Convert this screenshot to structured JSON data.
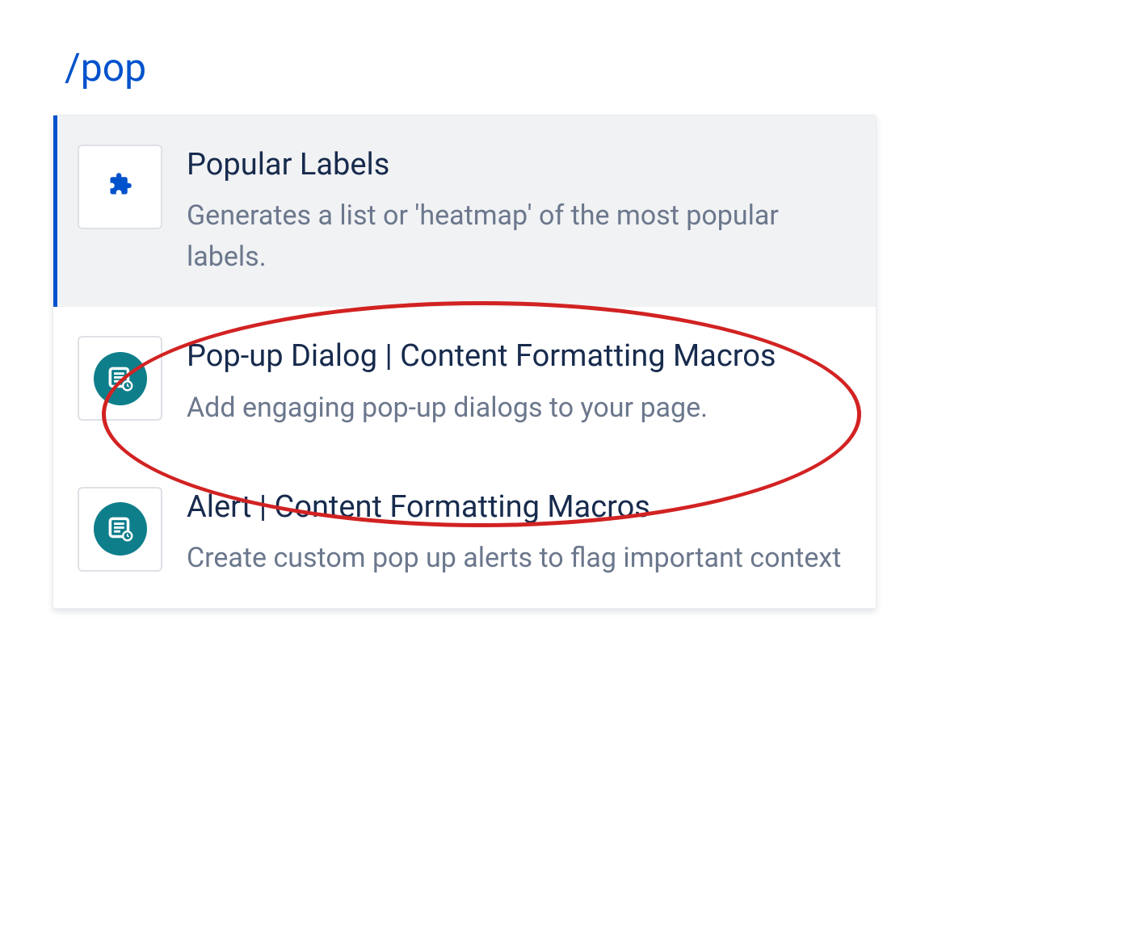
{
  "slash_input": "/pop",
  "menu": {
    "items": [
      {
        "title": "Popular Labels",
        "description": "Generates a list or 'heatmap' of the most popular labels.",
        "icon_name": "puzzle-piece-icon",
        "selected": true
      },
      {
        "title": "Pop-up Dialog | Content Formatting Macros",
        "description": "Add engaging pop-up dialogs to your page.",
        "icon_name": "content-macro-icon",
        "selected": false,
        "highlighted_annotation": true
      },
      {
        "title": "Alert | Content Formatting Macros",
        "description": "Create custom pop up alerts to flag important context",
        "icon_name": "content-macro-icon",
        "selected": false
      }
    ]
  },
  "colors": {
    "primary": "#0052cc",
    "text_dark": "#172b4d",
    "text_muted": "#6b778c",
    "teal": "#0e7e8b",
    "annotation_red": "#d22222"
  }
}
